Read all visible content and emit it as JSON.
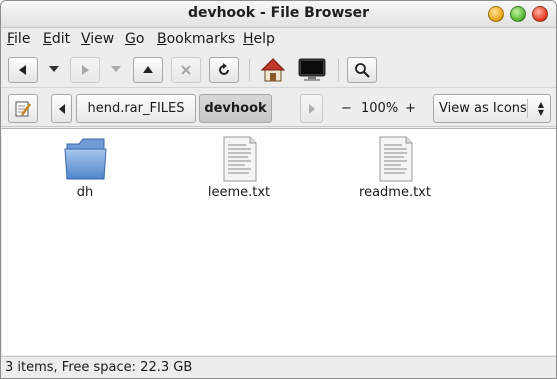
{
  "window": {
    "title": "devhook - File Browser"
  },
  "menubar": {
    "items": [
      {
        "accel": "F",
        "rest": "ile"
      },
      {
        "accel": "E",
        "rest": "dit"
      },
      {
        "accel": "V",
        "rest": "iew"
      },
      {
        "accel": "G",
        "rest": "o"
      },
      {
        "accel": "B",
        "rest": "ookmarks"
      },
      {
        "accel": "H",
        "rest": "elp"
      }
    ]
  },
  "toolbar": {
    "icons": [
      "back-icon",
      "forward-icon",
      "up-icon",
      "stop-icon",
      "reload-icon",
      "home-icon",
      "computer-icon",
      "search-icon"
    ]
  },
  "location": {
    "crumbs": [
      "hend.rar_FILES",
      "devhook"
    ],
    "zoom_out": "−",
    "zoom_level": "100%",
    "zoom_in": "+",
    "view_mode": "View as Icons"
  },
  "files": [
    {
      "name": "dh",
      "type": "folder"
    },
    {
      "name": "leeme.txt",
      "type": "text"
    },
    {
      "name": "readme.txt",
      "type": "text"
    }
  ],
  "status": {
    "text": "3 items, Free space: 22.3 GB"
  }
}
